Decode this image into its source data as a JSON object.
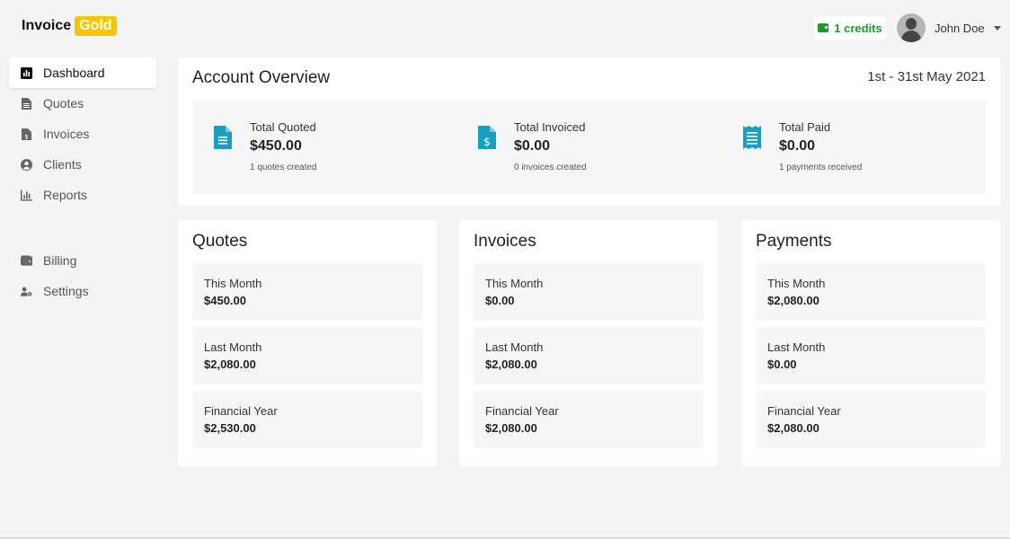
{
  "brand": {
    "name": "Invoice",
    "badge": "Gold"
  },
  "header": {
    "credits_label": "1 credits",
    "user_name": "John Doe"
  },
  "sidebar": {
    "items": [
      {
        "label": "Dashboard",
        "icon": "chart-icon"
      },
      {
        "label": "Quotes",
        "icon": "document-icon"
      },
      {
        "label": "Invoices",
        "icon": "invoice-icon"
      },
      {
        "label": "Clients",
        "icon": "user-circle-icon"
      },
      {
        "label": "Reports",
        "icon": "bar-chart-icon"
      },
      {
        "label": "Billing",
        "icon": "wallet-icon"
      },
      {
        "label": "Settings",
        "icon": "user-gear-icon"
      }
    ]
  },
  "overview": {
    "title": "Account Overview",
    "range": "1st - 31st May 2021",
    "stats": [
      {
        "label": "Total Quoted",
        "amount": "$450.00",
        "sub": "1 quotes created"
      },
      {
        "label": "Total Invoiced",
        "amount": "$0.00",
        "sub": "0 invoices created"
      },
      {
        "label": "Total Paid",
        "amount": "$0.00",
        "sub": "1 payments received"
      }
    ]
  },
  "panels": [
    {
      "title": "Quotes",
      "rows": [
        {
          "label": "This Month",
          "value": "$450.00"
        },
        {
          "label": "Last Month",
          "value": "$2,080.00"
        },
        {
          "label": "Financial Year",
          "value": "$2,530.00"
        }
      ]
    },
    {
      "title": "Invoices",
      "rows": [
        {
          "label": "This Month",
          "value": "$0.00"
        },
        {
          "label": "Last Month",
          "value": "$2,080.00"
        },
        {
          "label": "Financial Year",
          "value": "$2,080.00"
        }
      ]
    },
    {
      "title": "Payments",
      "rows": [
        {
          "label": "This Month",
          "value": "$2,080.00"
        },
        {
          "label": "Last Month",
          "value": "$0.00"
        },
        {
          "label": "Financial Year",
          "value": "$2,080.00"
        }
      ]
    }
  ],
  "colors": {
    "accent_gold": "#f7c600",
    "credits_green": "#1b9a2e",
    "icon_teal": "#1a9fbf"
  }
}
